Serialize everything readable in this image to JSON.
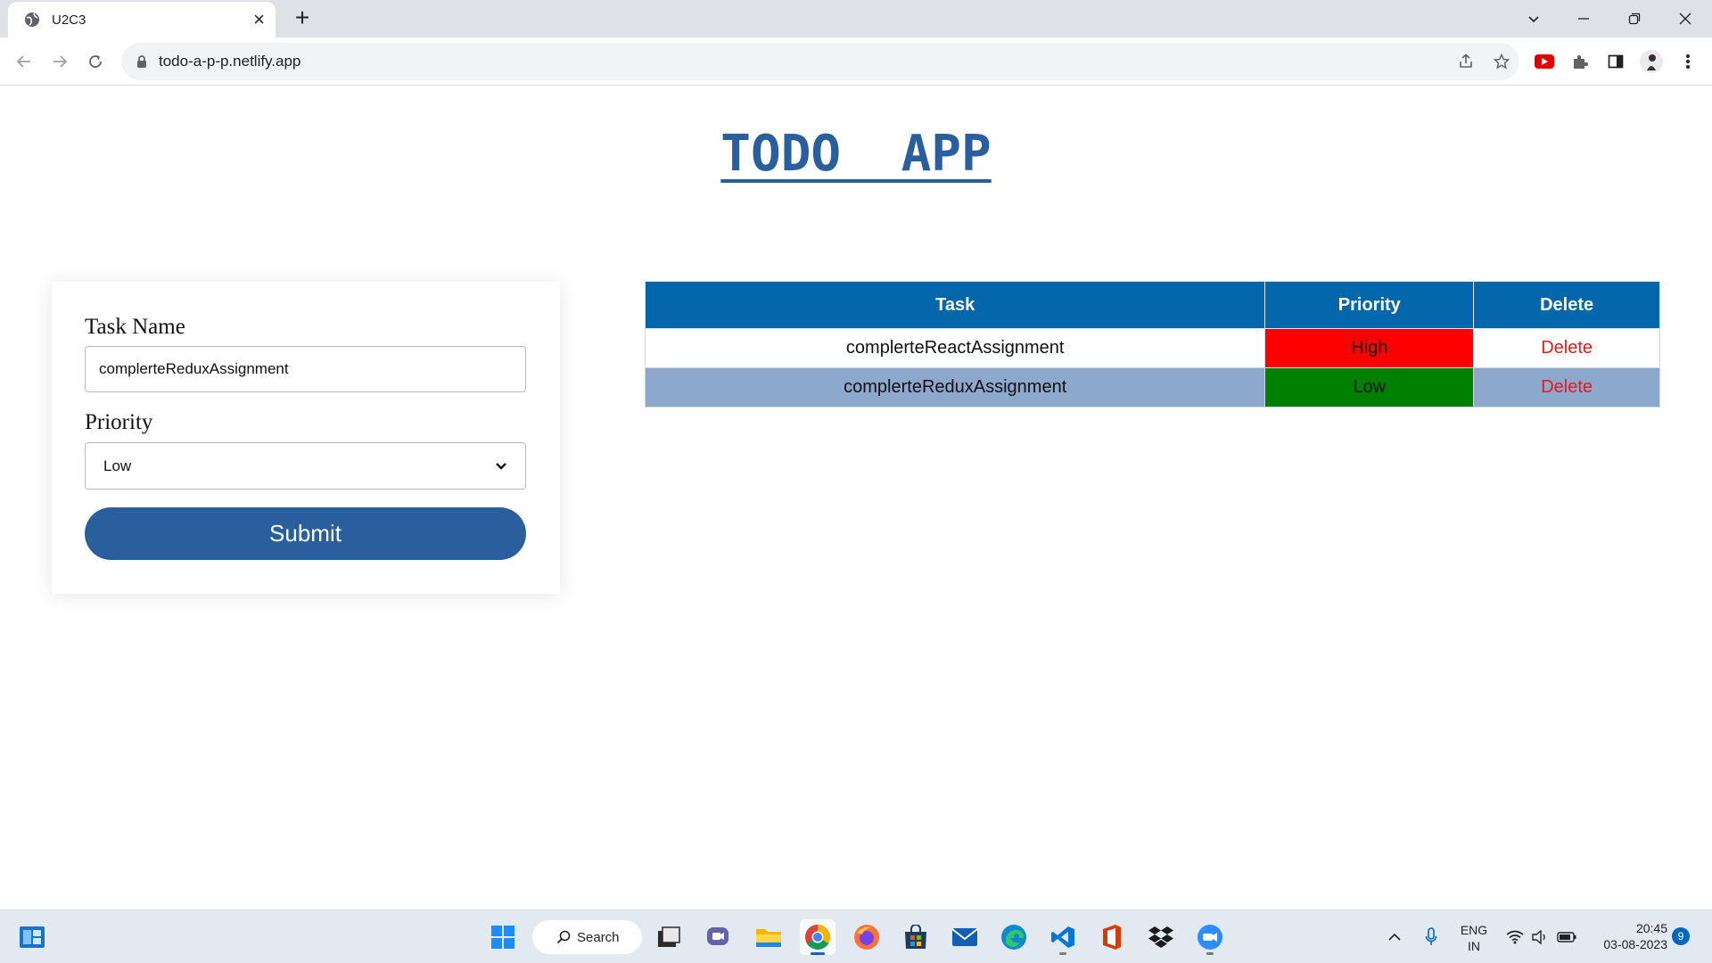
{
  "browser": {
    "tab_title": "U2C3",
    "url": "todo-a-p-p.netlify.app"
  },
  "page": {
    "title": "TODO  APP"
  },
  "form": {
    "task_label": "Task Name",
    "task_value": "complerteReduxAssignment",
    "priority_label": "Priority",
    "priority_value": "Low",
    "submit_label": "Submit"
  },
  "table": {
    "headers": {
      "task": "Task",
      "priority": "Priority",
      "delete": "Delete"
    },
    "rows": [
      {
        "task": "complerteReactAssignment",
        "priority": "High",
        "priority_color": "#ff0000",
        "delete": "Delete"
      },
      {
        "task": "complerteReduxAssignment",
        "priority": "Low",
        "priority_color": "#008000",
        "delete": "Delete"
      }
    ]
  },
  "taskbar": {
    "search_label": "Search",
    "lang_line1": "ENG",
    "lang_line2": "IN",
    "time": "20:45",
    "date": "03-08-2023",
    "notification_count": "9"
  },
  "colors": {
    "accent": "#2a5f9e",
    "table_header": "#0567ab",
    "alt_row": "#8ca8cc",
    "delete_text": "#e21b1b"
  }
}
